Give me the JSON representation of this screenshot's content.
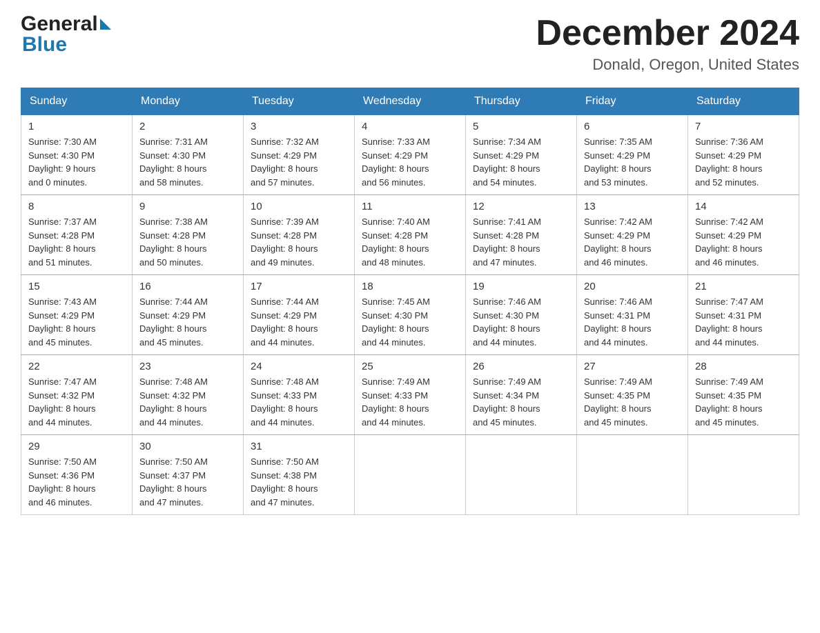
{
  "header": {
    "logo": {
      "general": "General",
      "blue": "Blue"
    },
    "title": "December 2024",
    "location": "Donald, Oregon, United States"
  },
  "calendar": {
    "days_of_week": [
      "Sunday",
      "Monday",
      "Tuesday",
      "Wednesday",
      "Thursday",
      "Friday",
      "Saturday"
    ],
    "weeks": [
      [
        {
          "day": "1",
          "sunrise": "7:30 AM",
          "sunset": "4:30 PM",
          "daylight": "9 hours and 0 minutes."
        },
        {
          "day": "2",
          "sunrise": "7:31 AM",
          "sunset": "4:30 PM",
          "daylight": "8 hours and 58 minutes."
        },
        {
          "day": "3",
          "sunrise": "7:32 AM",
          "sunset": "4:29 PM",
          "daylight": "8 hours and 57 minutes."
        },
        {
          "day": "4",
          "sunrise": "7:33 AM",
          "sunset": "4:29 PM",
          "daylight": "8 hours and 56 minutes."
        },
        {
          "day": "5",
          "sunrise": "7:34 AM",
          "sunset": "4:29 PM",
          "daylight": "8 hours and 54 minutes."
        },
        {
          "day": "6",
          "sunrise": "7:35 AM",
          "sunset": "4:29 PM",
          "daylight": "8 hours and 53 minutes."
        },
        {
          "day": "7",
          "sunrise": "7:36 AM",
          "sunset": "4:29 PM",
          "daylight": "8 hours and 52 minutes."
        }
      ],
      [
        {
          "day": "8",
          "sunrise": "7:37 AM",
          "sunset": "4:28 PM",
          "daylight": "8 hours and 51 minutes."
        },
        {
          "day": "9",
          "sunrise": "7:38 AM",
          "sunset": "4:28 PM",
          "daylight": "8 hours and 50 minutes."
        },
        {
          "day": "10",
          "sunrise": "7:39 AM",
          "sunset": "4:28 PM",
          "daylight": "8 hours and 49 minutes."
        },
        {
          "day": "11",
          "sunrise": "7:40 AM",
          "sunset": "4:28 PM",
          "daylight": "8 hours and 48 minutes."
        },
        {
          "day": "12",
          "sunrise": "7:41 AM",
          "sunset": "4:28 PM",
          "daylight": "8 hours and 47 minutes."
        },
        {
          "day": "13",
          "sunrise": "7:42 AM",
          "sunset": "4:29 PM",
          "daylight": "8 hours and 46 minutes."
        },
        {
          "day": "14",
          "sunrise": "7:42 AM",
          "sunset": "4:29 PM",
          "daylight": "8 hours and 46 minutes."
        }
      ],
      [
        {
          "day": "15",
          "sunrise": "7:43 AM",
          "sunset": "4:29 PM",
          "daylight": "8 hours and 45 minutes."
        },
        {
          "day": "16",
          "sunrise": "7:44 AM",
          "sunset": "4:29 PM",
          "daylight": "8 hours and 45 minutes."
        },
        {
          "day": "17",
          "sunrise": "7:44 AM",
          "sunset": "4:29 PM",
          "daylight": "8 hours and 44 minutes."
        },
        {
          "day": "18",
          "sunrise": "7:45 AM",
          "sunset": "4:30 PM",
          "daylight": "8 hours and 44 minutes."
        },
        {
          "day": "19",
          "sunrise": "7:46 AM",
          "sunset": "4:30 PM",
          "daylight": "8 hours and 44 minutes."
        },
        {
          "day": "20",
          "sunrise": "7:46 AM",
          "sunset": "4:31 PM",
          "daylight": "8 hours and 44 minutes."
        },
        {
          "day": "21",
          "sunrise": "7:47 AM",
          "sunset": "4:31 PM",
          "daylight": "8 hours and 44 minutes."
        }
      ],
      [
        {
          "day": "22",
          "sunrise": "7:47 AM",
          "sunset": "4:32 PM",
          "daylight": "8 hours and 44 minutes."
        },
        {
          "day": "23",
          "sunrise": "7:48 AM",
          "sunset": "4:32 PM",
          "daylight": "8 hours and 44 minutes."
        },
        {
          "day": "24",
          "sunrise": "7:48 AM",
          "sunset": "4:33 PM",
          "daylight": "8 hours and 44 minutes."
        },
        {
          "day": "25",
          "sunrise": "7:49 AM",
          "sunset": "4:33 PM",
          "daylight": "8 hours and 44 minutes."
        },
        {
          "day": "26",
          "sunrise": "7:49 AM",
          "sunset": "4:34 PM",
          "daylight": "8 hours and 45 minutes."
        },
        {
          "day": "27",
          "sunrise": "7:49 AM",
          "sunset": "4:35 PM",
          "daylight": "8 hours and 45 minutes."
        },
        {
          "day": "28",
          "sunrise": "7:49 AM",
          "sunset": "4:35 PM",
          "daylight": "8 hours and 45 minutes."
        }
      ],
      [
        {
          "day": "29",
          "sunrise": "7:50 AM",
          "sunset": "4:36 PM",
          "daylight": "8 hours and 46 minutes."
        },
        {
          "day": "30",
          "sunrise": "7:50 AM",
          "sunset": "4:37 PM",
          "daylight": "8 hours and 47 minutes."
        },
        {
          "day": "31",
          "sunrise": "7:50 AM",
          "sunset": "4:38 PM",
          "daylight": "8 hours and 47 minutes."
        },
        null,
        null,
        null,
        null
      ]
    ]
  }
}
